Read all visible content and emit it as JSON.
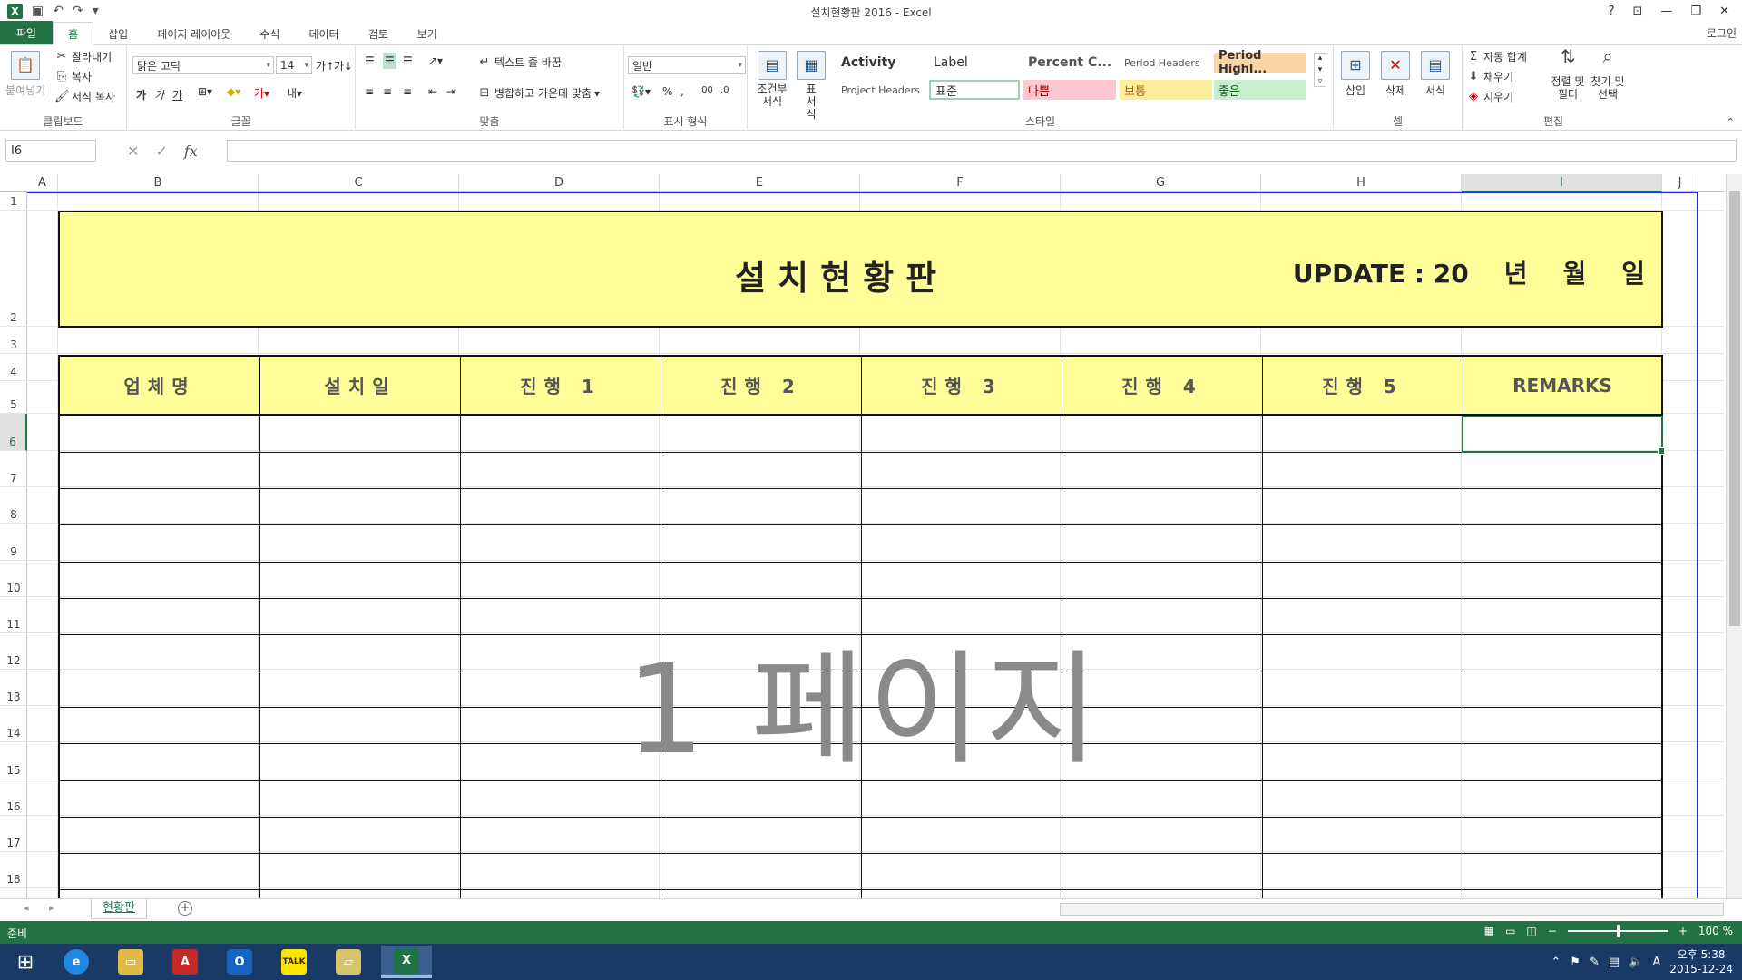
{
  "window": {
    "title": "설치현황판 2016 - Excel"
  },
  "tabs": [
    {
      "label": "파일"
    },
    {
      "label": "홈"
    },
    {
      "label": "삽입"
    },
    {
      "label": "페이지 레이아웃"
    },
    {
      "label": "수식"
    },
    {
      "label": "데이터"
    },
    {
      "label": "검토"
    },
    {
      "label": "보기"
    }
  ],
  "signin": "로그인",
  "ribbon": {
    "clipboard": {
      "paste": "붙여넣기",
      "cut": "잘라내기",
      "copy": "복사",
      "format_painter": "서식 복사",
      "label": "클립보드"
    },
    "font": {
      "name": "맑은 고딕",
      "size": "14",
      "label": "글꼴",
      "bold": "가",
      "italic": "가",
      "underline": "가"
    },
    "align": {
      "wrap": "텍스트 줄 바꿈",
      "merge": "병합하고 가운데 맞춤",
      "label": "맞춤"
    },
    "number": {
      "format": "일반",
      "label": "표시 형식"
    },
    "styles": {
      "conditional": "조건부 서식",
      "table": "표 서식",
      "label": "스타일",
      "cells": [
        "Activity",
        "Label",
        "Percent C...",
        "Period Headers",
        "Period Highl...",
        "Project Headers",
        "표준",
        "나쁨",
        "보통",
        "좋음"
      ]
    },
    "cells": {
      "insert": "삽입",
      "delete": "삭제",
      "format": "서식",
      "label": "셀"
    },
    "editing": {
      "autosum": "자동 합계",
      "fill": "채우기",
      "clear": "지우기",
      "sort": "정렬 및 필터",
      "find": "찾기 및 선택",
      "label": "편집"
    }
  },
  "formula_bar": {
    "name_box": "I6",
    "formula": "",
    "fx": "fx"
  },
  "columns": [
    "A",
    "B",
    "C",
    "D",
    "E",
    "F",
    "G",
    "H",
    "I",
    "J"
  ],
  "selected_column": "I",
  "rows": [
    "1",
    "2",
    "3",
    "4",
    "5",
    "6",
    "7",
    "8",
    "9",
    "10",
    "11",
    "12",
    "13",
    "14",
    "15",
    "16",
    "17",
    "18"
  ],
  "selected_row": "6",
  "sheet": {
    "title": "설치현황판",
    "update": "UPDATE : 20    년    월    일",
    "headers": [
      "업체명",
      "설치일",
      "진행 1",
      "진행 2",
      "진행 3",
      "진행 4",
      "진행 5",
      "REMARKS"
    ],
    "watermark": "1 페이지"
  },
  "sheet_tabs": [
    {
      "label": "현황판"
    }
  ],
  "status": {
    "ready": "준비",
    "zoom": "100 %"
  },
  "taskbar": {
    "time": "오후 5:38",
    "date": "2015-12-24",
    "ime": "A"
  },
  "colors": {
    "accent": "#217346",
    "header_fill": "#ffff99",
    "page_break": "#2b2bdc"
  }
}
